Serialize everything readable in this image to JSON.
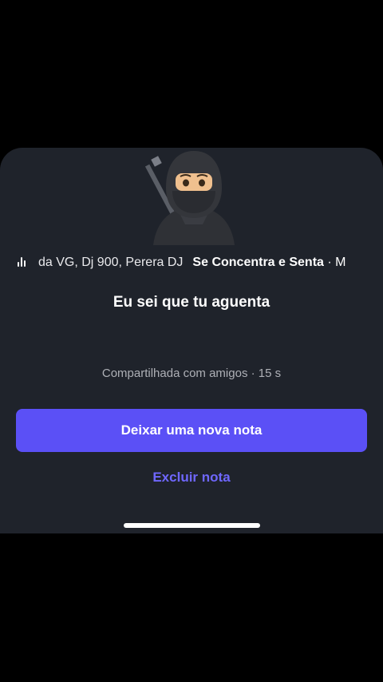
{
  "note_sheet": {
    "music": {
      "artists": "da VG, Dj 900, Perera DJ",
      "song": "Se Concentra e Senta",
      "separator": "·",
      "truncated_next": "M",
      "icon": "equalizer-icon"
    },
    "avatar_icon": "ninja-emoji",
    "note_text": "Eu sei que tu aguenta",
    "meta": "Compartilhada com amigos · 15 s",
    "primary_button_label": "Deixar uma nova nota",
    "secondary_button_label": "Excluir nota"
  },
  "colors": {
    "sheet_bg": "#1f232b",
    "accent": "#5b50f6",
    "link": "#6f67ff"
  }
}
